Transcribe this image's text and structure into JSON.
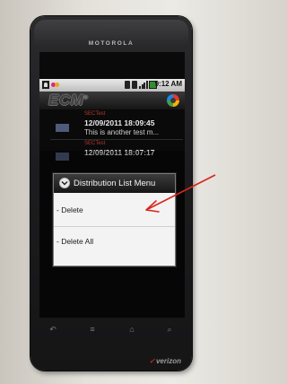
{
  "device": {
    "brand": "MOTOROLA",
    "carrier": "verizon"
  },
  "status_bar": {
    "time": "9:12 AM",
    "icons": [
      "contact-icon",
      "app-notification-icon",
      "bluetooth-icon",
      "phone-icon",
      "signal-icon",
      "battery-icon"
    ]
  },
  "app": {
    "logo": "ECM",
    "logo_mark": "®"
  },
  "messages": [
    {
      "sender": "SECTest",
      "date": "12/09/2011 18:09:45",
      "preview": "This is another test m..."
    },
    {
      "sender": "SECTest",
      "date": "12/09/2011 18:07:17",
      "preview": ""
    }
  ],
  "dialog": {
    "title": "Distribution List Menu",
    "items": [
      {
        "label": "- Delete"
      },
      {
        "label": "- Delete All"
      }
    ]
  },
  "softkeys": [
    "back-icon",
    "menu-icon",
    "home-icon",
    "search-icon"
  ],
  "colors": {
    "annotation_arrow": "#d8261c",
    "sender_red": "#b33a2e",
    "dialog_background": "#f3f3f3"
  }
}
